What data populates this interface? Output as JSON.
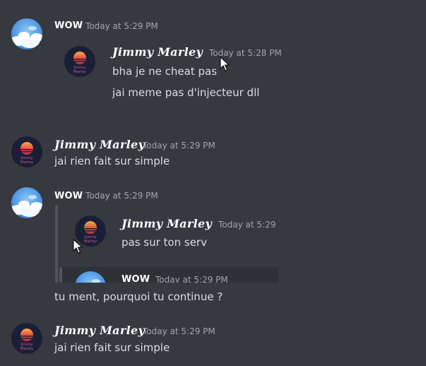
{
  "messages": [
    {
      "author": "WOW",
      "timestamp": "Today at 5:29 PM",
      "quote": {
        "author": "Jimmy Marley",
        "timestamp": "Today at 5:28 PM",
        "lines": [
          "bha je ne cheat pas",
          "jai meme pas d'injecteur dll"
        ]
      }
    },
    {
      "author": "Jimmy Marley",
      "timestamp": "Today at 5:29 PM",
      "text": "jai rien fait sur simple"
    },
    {
      "author": "WOW",
      "timestamp": "Today at 5:29 PM",
      "quote": {
        "author": "Jimmy Marley",
        "timestamp": "Today at 5:29",
        "lines": [
          "pas sur ton serv"
        ],
        "nested": {
          "author": "WOW",
          "timestamp": "Today at 5:29 PM"
        }
      },
      "text": "tu ment, pourquoi tu continue ?"
    },
    {
      "author": "Jimmy Marley",
      "timestamp": "Today at 5:29 PM",
      "text": "jai rien fait sur simple"
    }
  ],
  "avatar_text": "Jimmy Marley",
  "colors": {
    "background": "#36393f",
    "text": "#dcddde",
    "timestamp": "#a3a6aa",
    "username": "#ffffff",
    "quote_bar": "#4f545c"
  }
}
